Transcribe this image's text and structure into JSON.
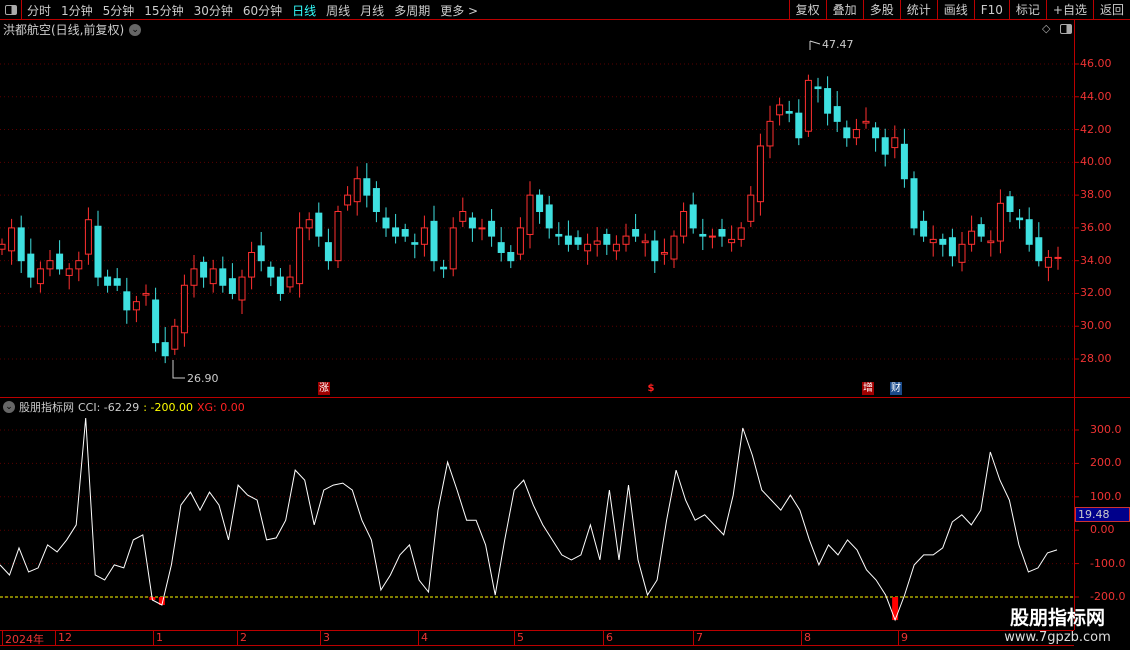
{
  "toolbar": {
    "periods": [
      "分时",
      "1分钟",
      "5分钟",
      "15分钟",
      "30分钟",
      "60分钟",
      "日线",
      "周线",
      "月线",
      "多周期",
      "更多 >"
    ],
    "active": "日线",
    "buttons": [
      "复权",
      "叠加",
      "多股",
      "统计",
      "画线",
      "F10",
      "标记",
      "+自选",
      "返回"
    ]
  },
  "stock_title": "洪都航空(日线,前复权)",
  "price_panel": {
    "high_label": "47.47",
    "low_label": "26.90",
    "y_ticks": [
      "46.00",
      "44.00",
      "42.00",
      "40.00",
      "38.00",
      "36.00",
      "34.00",
      "32.00",
      "30.00",
      "28.00"
    ],
    "markers": [
      {
        "text": "涨",
        "color": "#a00000"
      },
      {
        "text": "$",
        "color": "#ff2020"
      },
      {
        "text": "增",
        "color": "#a00000"
      },
      {
        "text": "财",
        "color": "#1a4a8a"
      }
    ]
  },
  "indicator": {
    "name": "股朋指标网",
    "cci_label": "CCI: -62.29",
    "level_label": ": -200.00",
    "xg_label": "XG: 0.00",
    "y_ticks": [
      "300.0",
      "200.0",
      "100.0",
      "0.00",
      "-100.0",
      "-200.0"
    ],
    "current_tag": "19.48"
  },
  "date_axis": {
    "labels": [
      "2024年",
      "12",
      "1",
      "2",
      "3",
      "4",
      "5",
      "6",
      "7",
      "8",
      "9"
    ]
  },
  "watermark": {
    "line1": "股朋指标网",
    "line2": "www.7gpzb.com"
  },
  "colors": {
    "up": "#ff3030",
    "down": "#3fe0e0",
    "cci": "#ffffff",
    "level": "#ffff00",
    "signal": "#ff0000",
    "axis": "#bb0000"
  },
  "chart_data": [
    {
      "type": "candlestick",
      "ylim": [
        26,
        47.5
      ],
      "closes": [
        35,
        36,
        34,
        33,
        33.5,
        34,
        33.5,
        33.5,
        34,
        36.5,
        33,
        32.5,
        32.5,
        31,
        31.5,
        32,
        29,
        28.2,
        30,
        32.5,
        33.5,
        33,
        33.5,
        32.5,
        32,
        33,
        34.5,
        34,
        33,
        32,
        33,
        36,
        36.5,
        35.5,
        34,
        37,
        38,
        39,
        38,
        37,
        36,
        35.5,
        35.5,
        35,
        36,
        34,
        33.5,
        36,
        37,
        36,
        36,
        35.5,
        34.5,
        34,
        36,
        38,
        37,
        36,
        35.5,
        35,
        35,
        35,
        35.2,
        35,
        35,
        35.5,
        35.5,
        35.2,
        34,
        34.5,
        35.5,
        37,
        36,
        35.5,
        35.5,
        35.5,
        35.3,
        36,
        38,
        41,
        42.5,
        43.5,
        43,
        41.5,
        45,
        44.5,
        43,
        42.5,
        41.5,
        42,
        42.5,
        41.5,
        40.5,
        41.5,
        39,
        36,
        35.5,
        35.3,
        35,
        34.3,
        35,
        35.8,
        35.5,
        35.2,
        37.5,
        37,
        36.5,
        35,
        34,
        34.2,
        34.2
      ],
      "high": 47.47,
      "low": 26.9
    },
    {
      "type": "line",
      "name": "CCI",
      "ylim": [
        -270,
        340
      ],
      "level": -200,
      "values": [
        -104,
        -134,
        -53,
        -125,
        -113,
        -44,
        -65,
        -29,
        16,
        336,
        -134,
        -149,
        -104,
        -113,
        -29,
        -14,
        -209,
        -224,
        -104,
        75,
        114,
        60,
        114,
        75,
        -29,
        135,
        105,
        90,
        -29,
        -23,
        30,
        180,
        150,
        16,
        120,
        135,
        141,
        120,
        30,
        -29,
        -179,
        -134,
        -74,
        -44,
        -149,
        -185,
        60,
        204,
        120,
        30,
        30,
        -44,
        -194,
        -29,
        120,
        150,
        75,
        16,
        -29,
        -74,
        -89,
        -74,
        16,
        -89,
        120,
        -89,
        135,
        -89,
        -194,
        -149,
        30,
        180,
        90,
        30,
        46,
        16,
        -14,
        105,
        306,
        225,
        120,
        90,
        60,
        105,
        60,
        -29,
        -104,
        -44,
        -74,
        -29,
        -59,
        -119,
        -149,
        -194,
        -269,
        -194,
        -104,
        -74,
        -74,
        -53,
        25,
        46,
        16,
        60,
        234,
        150,
        90,
        -44,
        -125,
        -113,
        -68,
        -59
      ]
    }
  ]
}
